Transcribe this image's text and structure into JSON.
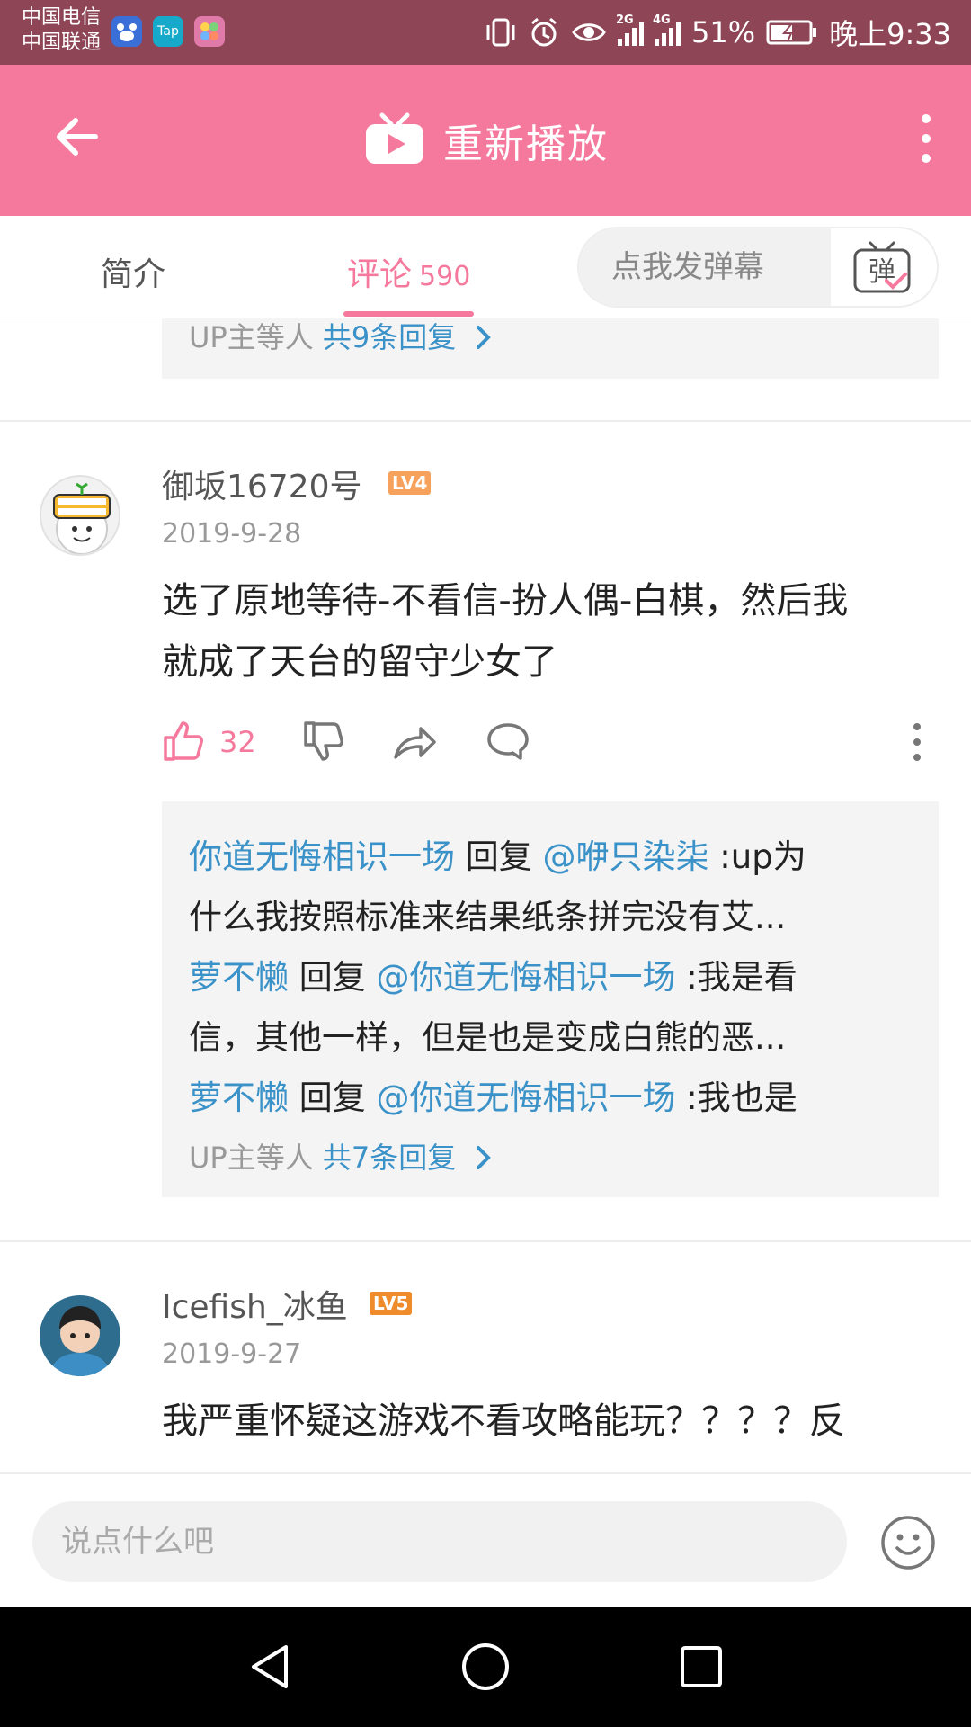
{
  "status_bar": {
    "carrier_1": "中国电信",
    "carrier_2": "中国联通",
    "app_icons": [
      "baidu-icon",
      "tap-icon",
      "gallery-icon"
    ],
    "tap_label": "Tap",
    "network_1": "2G",
    "network_2": "4G",
    "battery": "51%",
    "time": "晚上9:33"
  },
  "header": {
    "title": "重新播放",
    "bg_color": "#f5799d"
  },
  "tabs": {
    "intro": "简介",
    "comments": "评论",
    "comments_count": "590",
    "active": "comments",
    "danmaku_placeholder": "点我发弹幕",
    "danmaku_icon_label": "弹"
  },
  "prev_comment": {
    "replies_from": "UP主等人",
    "replies_count": "共9条回复"
  },
  "comment_1": {
    "username": "御坂16720号",
    "level": "LV4",
    "level_color": "#f6a15c",
    "date": "2019-9-28",
    "text_line1": "选了原地等待-不看信-扮人偶-白棋，然后我",
    "text_line2": "就成了天台的留守少女了",
    "likes": "32",
    "replies": [
      {
        "user": "你道无悔相识一场",
        "verb": "回复",
        "target": "@咿只染柒",
        "content_1": ":up为",
        "content_2": "什么我按照标准来结果纸条拼完没有艾..."
      },
      {
        "user": "萝不懒",
        "verb": "回复",
        "target": "@你道无悔相识一场",
        "content_1": ":我是看",
        "content_2": "信，其他一样，但是也是变成白熊的恶..."
      },
      {
        "user": "萝不懒",
        "verb": "回复",
        "target": "@你道无悔相识一场",
        "content_1": ":我也是"
      }
    ],
    "replies_from": "UP主等人",
    "replies_count": "共7条回复"
  },
  "comment_2": {
    "username": "Icefish_冰鱼",
    "level": "LV5",
    "level_color": "#f08b2c",
    "date": "2019-9-27",
    "text_line1": "我严重怀疑这游戏不看攻略能玩？？？？反"
  },
  "bottom_input": {
    "placeholder": "说点什么吧"
  },
  "accent_color": "#f5799d",
  "link_color": "#3a92c8"
}
